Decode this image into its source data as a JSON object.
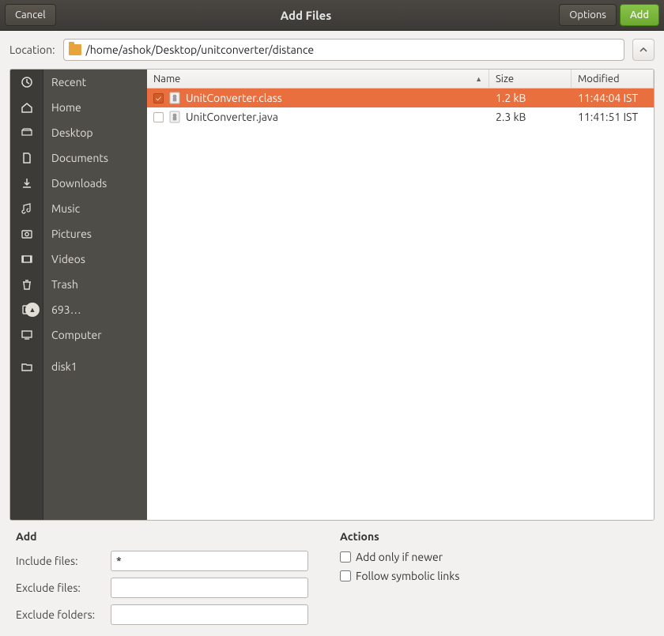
{
  "header": {
    "title": "Add Files",
    "cancel": "Cancel",
    "options": "Options",
    "add": "Add"
  },
  "location": {
    "label": "Location:",
    "path": "/home/ashok/Desktop/unitconverter/distance"
  },
  "sidebar": {
    "recent": "Recent",
    "home": "Home",
    "desktop": "Desktop",
    "documents": "Documents",
    "downloads": "Downloads",
    "music": "Music",
    "pictures": "Pictures",
    "videos": "Videos",
    "trash": "Trash",
    "volume": "693…",
    "computer": "Computer",
    "disk1": "disk1"
  },
  "columns": {
    "name": "Name",
    "size": "Size",
    "modified": "Modified"
  },
  "files": [
    {
      "name": "UnitConverter.class",
      "size": "1.2 kB",
      "modified": "11:44:04  IST",
      "selected": true
    },
    {
      "name": "UnitConverter.java",
      "size": "2.3 kB",
      "modified": "11:41:51  IST",
      "selected": false
    }
  ],
  "bottom": {
    "add_header": "Add",
    "include_label": "Include files:",
    "include_value": "*",
    "exclude_files_label": "Exclude files:",
    "exclude_files_value": "",
    "exclude_folders_label": "Exclude folders:",
    "exclude_folders_value": "",
    "actions_header": "Actions",
    "only_newer": "Add only if newer",
    "follow_symlinks": "Follow symbolic links"
  }
}
